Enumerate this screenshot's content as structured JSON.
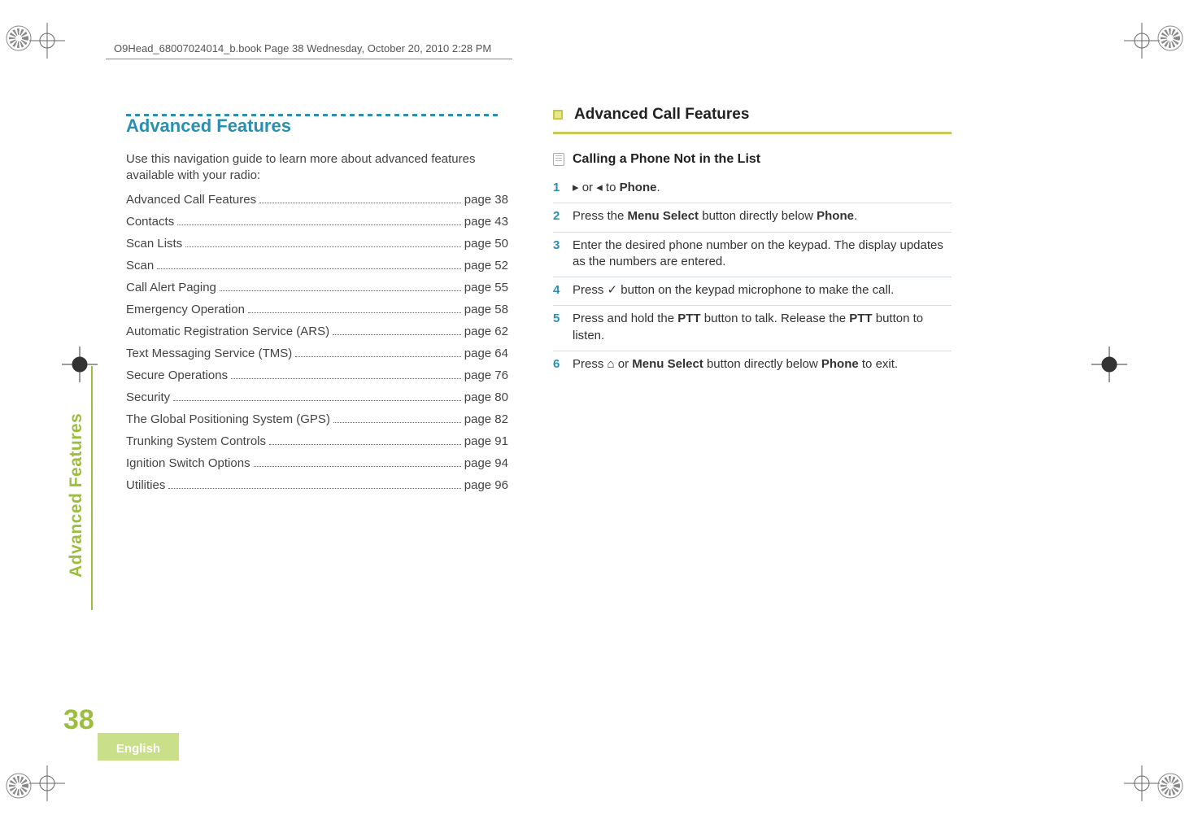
{
  "header": {
    "text": "O9Head_68007024014_b.book  Page 38  Wednesday, October 20, 2010  2:28 PM"
  },
  "left": {
    "title": "Advanced Features",
    "intro": "Use this navigation guide to learn more about advanced features available with your radio:",
    "toc": [
      {
        "label": "Advanced Call Features",
        "page": "page 38"
      },
      {
        "label": "Contacts",
        "page": "page 43"
      },
      {
        "label": "Scan Lists",
        "page": "page 50"
      },
      {
        "label": "Scan",
        "page": "page 52"
      },
      {
        "label": "Call Alert Paging",
        "page": "page 55"
      },
      {
        "label": "Emergency Operation",
        "page": "page 58"
      },
      {
        "label": "Automatic Registration Service (ARS)",
        "page": "page 62"
      },
      {
        "label": "Text Messaging Service (TMS)",
        "page": "page 64"
      },
      {
        "label": "Secure Operations",
        "page": "page 76"
      },
      {
        "label": "Security",
        "page": "page 80"
      },
      {
        "label": "The Global Positioning System (GPS)",
        "page": "page 82"
      },
      {
        "label": "Trunking System Controls",
        "page": "page 91"
      },
      {
        "label": "Ignition Switch Options",
        "page": "page 94"
      },
      {
        "label": "Utilities",
        "page": "page 96"
      }
    ]
  },
  "right": {
    "section_title": "Advanced Call Features",
    "procedure_title": "Calling a Phone Not in the List",
    "steps": {
      "s1_pre": "",
      "s1_glyph1": "▸",
      "s1_mid": " or ",
      "s1_glyph2": "◂",
      "s1_mid2": " to ",
      "s1_target": "Phone",
      "s1_end": ".",
      "s2_a": "Press the ",
      "s2_b": "Menu Select",
      "s2_c": " button directly below ",
      "s2_d": "Phone",
      "s2_e": ".",
      "s3": "Enter the desired phone number on the keypad. The display updates as the numbers are entered.",
      "s4_a": "Press ",
      "s4_glyph": "✓",
      "s4_b": " button on the keypad microphone to make the call.",
      "s5_a": "Press and hold the ",
      "s5_b": "PTT",
      "s5_c": " button to talk. Release the ",
      "s5_d": "PTT",
      "s5_e": " button to listen.",
      "s6_a": "Press ",
      "s6_home": "⌂",
      "s6_b": " or ",
      "s6_c": "Menu Select",
      "s6_d": " button directly below ",
      "s6_e": "Phone",
      "s6_f": " to exit."
    },
    "nums": {
      "n1": "1",
      "n2": "2",
      "n3": "3",
      "n4": "4",
      "n5": "5",
      "n6": "6"
    }
  },
  "sidebar": {
    "label": "Advanced Features",
    "page_number": "38",
    "language": "English"
  }
}
